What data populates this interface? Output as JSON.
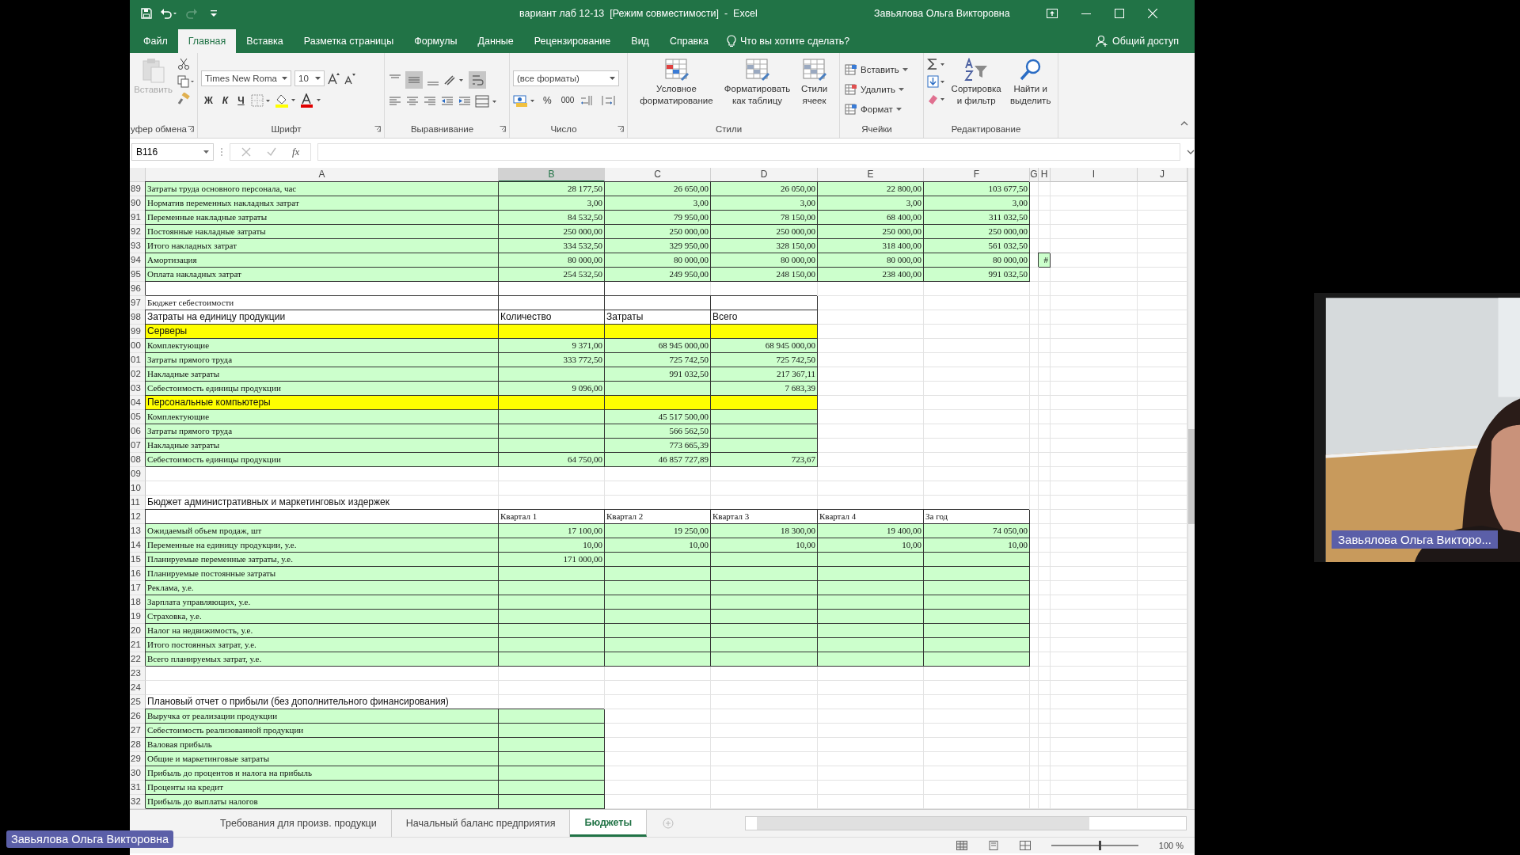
{
  "window": {
    "title": "вариант лаб 12-13  [Режим совместимости]  -  Excel",
    "user": "Завьялова Ольга Викторовна"
  },
  "tabs": [
    {
      "label": "Файл",
      "selected": false
    },
    {
      "label": "Главная",
      "selected": true
    },
    {
      "label": "Вставка",
      "selected": false
    },
    {
      "label": "Разметка страницы",
      "selected": false
    },
    {
      "label": "Формулы",
      "selected": false
    },
    {
      "label": "Данные",
      "selected": false
    },
    {
      "label": "Рецензирование",
      "selected": false
    },
    {
      "label": "Вид",
      "selected": false
    },
    {
      "label": "Справка",
      "selected": false
    }
  ],
  "tell_me": "Что вы хотите сделать?",
  "share": "Общий доступ",
  "ribbon": {
    "clipboard": {
      "paste": "Вставить",
      "label": "уфер обмена"
    },
    "font": {
      "name": "Times New Roma",
      "size": "10",
      "bold": "Ж",
      "italic": "К",
      "underline": "Ч",
      "label": "Шрифт"
    },
    "alignment": {
      "label": "Выравнивание"
    },
    "number": {
      "format": "(все форматы)",
      "percent": "%",
      "thousands": "000",
      "label": "Число"
    },
    "styles": {
      "buttons": [
        "Условное форматирование",
        "Форматировать как таблицу",
        "Стили ячеек"
      ],
      "label": "Стили"
    },
    "cells": {
      "buttons": [
        "Вставить",
        "Удалить",
        "Формат"
      ],
      "label": "Ячейки"
    },
    "editing": {
      "buttons": [
        "Сортировка и фильтр",
        "Найти и выделить"
      ],
      "label": "Редактирование"
    }
  },
  "formula_bar": {
    "name_box": "B116",
    "fx": "fx"
  },
  "columns": [
    {
      "label": "A",
      "selected": false
    },
    {
      "label": "B",
      "selected": true
    },
    {
      "label": "C",
      "selected": false
    },
    {
      "label": "D",
      "selected": false
    },
    {
      "label": "E",
      "selected": false
    },
    {
      "label": "F",
      "selected": false
    },
    {
      "label": "G",
      "selected": false
    },
    {
      "label": "H",
      "selected": false
    },
    {
      "label": "I",
      "selected": false
    },
    {
      "label": "J",
      "selected": false
    }
  ],
  "rows": [
    {
      "num": "89",
      "kind": "data",
      "cells": [
        {
          "text": "Затраты труда основного персонала, час",
          "color": "#ccffcc"
        },
        {
          "text": "28 177,50",
          "color": "#ccffcc"
        },
        {
          "text": "26 650,00",
          "color": "#ccffcc"
        },
        {
          "text": "26 050,00",
          "color": "#ccffcc"
        },
        {
          "text": "22 800,00",
          "color": "#ccffcc"
        },
        {
          "text": "103 677,50",
          "color": "#ccffcc"
        }
      ]
    },
    {
      "num": "90",
      "kind": "data",
      "cells": [
        {
          "text": "Норматив переменных накладных затрат",
          "color": "#ccffcc"
        },
        {
          "text": "3,00",
          "color": "#ccffcc"
        },
        {
          "text": "3,00",
          "color": "#ccffcc"
        },
        {
          "text": "3,00",
          "color": "#ccffcc"
        },
        {
          "text": "3,00",
          "color": "#ccffcc"
        },
        {
          "text": "3,00",
          "color": "#ccffcc"
        }
      ]
    },
    {
      "num": "91",
      "kind": "data",
      "cells": [
        {
          "text": "Переменные накладные затраты",
          "color": "#ccffcc"
        },
        {
          "text": "84 532,50",
          "color": "#ccffcc"
        },
        {
          "text": "79 950,00",
          "color": "#ccffcc"
        },
        {
          "text": "78 150,00",
          "color": "#ccffcc"
        },
        {
          "text": "68 400,00",
          "color": "#ccffcc"
        },
        {
          "text": "311 032,50",
          "color": "#ccffcc"
        }
      ]
    },
    {
      "num": "92",
      "kind": "data",
      "cells": [
        {
          "text": "Постоянные накладные затраты",
          "color": "#ccffcc"
        },
        {
          "text": "250 000,00",
          "color": "#ccffcc"
        },
        {
          "text": "250 000,00",
          "color": "#ccffcc"
        },
        {
          "text": "250 000,00",
          "color": "#ccffcc"
        },
        {
          "text": "250 000,00",
          "color": "#ccffcc"
        },
        {
          "text": "250 000,00",
          "color": "#ccffcc"
        }
      ]
    },
    {
      "num": "93",
      "kind": "data",
      "cells": [
        {
          "text": "Итого накладных затрат",
          "color": "#ccffcc"
        },
        {
          "text": "334 532,50",
          "color": "#ccffcc"
        },
        {
          "text": "329 950,00",
          "color": "#ccffcc"
        },
        {
          "text": "328 150,00",
          "color": "#ccffcc"
        },
        {
          "text": "318 400,00",
          "color": "#ccffcc"
        },
        {
          "text": "561 032,50",
          "color": "#ccffcc"
        }
      ]
    },
    {
      "num": "94",
      "kind": "data",
      "cells": [
        {
          "text": "Амортизация",
          "color": "#ccffcc"
        },
        {
          "text": "80 000,00",
          "color": "#ccffcc"
        },
        {
          "text": "80 000,00",
          "color": "#ccffcc"
        },
        {
          "text": "80 000,00",
          "color": "#ccffcc"
        },
        {
          "text": "80 000,00",
          "color": "#ccffcc"
        },
        {
          "text": "80 000,00",
          "color": "#ccffcc"
        },
        {},
        {
          "text": "#",
          "color": "#ccffcc"
        }
      ]
    },
    {
      "num": "95",
      "kind": "data",
      "cells": [
        {
          "text": "Оплата накладных затрат",
          "color": "#ccffcc"
        },
        {
          "text": "254 532,50",
          "color": "#ccffcc"
        },
        {
          "text": "249 950,00",
          "color": "#ccffcc"
        },
        {
          "text": "248 150,00",
          "color": "#ccffcc"
        },
        {
          "text": "238 400,00",
          "color": "#ccffcc"
        },
        {
          "text": "991 032,50",
          "color": "#ccffcc"
        }
      ]
    },
    {
      "num": "96",
      "kind": "data",
      "cells": [
        {
          "boxed": true
        },
        {
          "boxed": true
        }
      ]
    },
    {
      "num": "97",
      "kind": "labels",
      "cells": [
        {
          "text": "Бюджет себестоимости"
        },
        {
          "boxed": true
        },
        {
          "boxed": true
        },
        {
          "boxed": true
        }
      ]
    },
    {
      "num": "98",
      "kind": "heading",
      "cells": [
        {
          "text": "Затраты на единицу продукции",
          "boxed": true
        },
        {
          "text": "Количество",
          "boxed": true
        },
        {
          "text": "Затраты",
          "boxed": true
        },
        {
          "text": "Всего",
          "boxed": true
        }
      ]
    },
    {
      "num": "99",
      "kind": "heading",
      "cells": [
        {
          "text": "Серверы",
          "color": "#ffff00"
        },
        {
          "color": "#ffff00"
        },
        {
          "color": "#ffff00"
        },
        {
          "color": "#ffff00"
        }
      ]
    },
    {
      "num": "00",
      "kind": "data",
      "cells": [
        {
          "text": "Комплектующие",
          "color": "#ccffcc"
        },
        {
          "text": "9 371,00",
          "color": "#ccffcc"
        },
        {
          "text": "68 945 000,00",
          "color": "#ccffcc"
        },
        {
          "text": "68 945 000,00",
          "color": "#ccffcc"
        }
      ]
    },
    {
      "num": "01",
      "kind": "data",
      "cells": [
        {
          "text": "Затраты прямого труда",
          "color": "#ccffcc"
        },
        {
          "text": "333 772,50",
          "color": "#ccffcc"
        },
        {
          "text": "725 742,50",
          "color": "#ccffcc"
        },
        {
          "text": "725 742,50",
          "color": "#ccffcc"
        }
      ]
    },
    {
      "num": "02",
      "kind": "data",
      "cells": [
        {
          "text": "Накладные затраты",
          "color": "#ccffcc"
        },
        {
          "color": "#ccffcc"
        },
        {
          "text": "991 032,50",
          "color": "#ccffcc"
        },
        {
          "text": "217 367,11",
          "color": "#ccffcc"
        }
      ]
    },
    {
      "num": "03",
      "kind": "data",
      "cells": [
        {
          "text": "Себестоимость единицы продукции",
          "color": "#ccffcc"
        },
        {
          "text": "9 096,00",
          "color": "#ccffcc"
        },
        {
          "color": "#ccffcc"
        },
        {
          "text": "7 683,39",
          "color": "#ccffcc"
        }
      ]
    },
    {
      "num": "04",
      "kind": "heading",
      "cells": [
        {
          "text": "Персональные компьютеры",
          "color": "#ffff00"
        },
        {
          "color": "#ffff00"
        },
        {
          "color": "#ffff00"
        },
        {
          "color": "#ffff00"
        }
      ]
    },
    {
      "num": "05",
      "kind": "data",
      "cells": [
        {
          "text": "Комплектующие",
          "color": "#ccffcc"
        },
        {
          "color": "#ccffcc"
        },
        {
          "text": "45 517 500,00",
          "color": "#ccffcc"
        },
        {
          "color": "#ccffcc"
        }
      ]
    },
    {
      "num": "06",
      "kind": "data",
      "cells": [
        {
          "text": "Затраты прямого труда",
          "color": "#ccffcc"
        },
        {
          "color": "#ccffcc"
        },
        {
          "text": "566 562,50",
          "color": "#ccffcc"
        },
        {
          "color": "#ccffcc"
        }
      ]
    },
    {
      "num": "07",
      "kind": "data",
      "cells": [
        {
          "text": "Накладные затраты",
          "color": "#ccffcc"
        },
        {
          "color": "#ccffcc"
        },
        {
          "text": "773 665,39",
          "color": "#ccffcc"
        },
        {
          "color": "#ccffcc"
        }
      ]
    },
    {
      "num": "08",
      "kind": "data",
      "cells": [
        {
          "text": "Себестоимость единицы продукции",
          "color": "#ccffcc"
        },
        {
          "text": "64 750,00",
          "color": "#ccffcc"
        },
        {
          "text": "46 857 727,89",
          "color": "#ccffcc"
        },
        {
          "text": "723,67",
          "color": "#ccffcc"
        }
      ]
    },
    {
      "num": "09",
      "cells": []
    },
    {
      "num": "10",
      "cells": []
    },
    {
      "num": "11",
      "kind": "heading",
      "cells": [
        {
          "text": "Бюджет административных и маркетинговых издержек"
        }
      ]
    },
    {
      "num": "12",
      "kind": "labels",
      "cells": [
        {
          "boxed": true
        },
        {
          "text": "Квартал 1",
          "boxed": true
        },
        {
          "text": "Квартал 2",
          "boxed": true
        },
        {
          "text": "Квартал 3",
          "boxed": true
        },
        {
          "text": "Квартал 4",
          "boxed": true
        },
        {
          "text": "За год",
          "boxed": true
        }
      ]
    },
    {
      "num": "13",
      "kind": "data",
      "cells": [
        {
          "text": "Ожидаемый объем продаж, шт",
          "color": "#ccffcc"
        },
        {
          "text": "17 100,00",
          "color": "#ccffcc"
        },
        {
          "text": "19 250,00",
          "color": "#ccffcc"
        },
        {
          "text": "18 300,00",
          "color": "#ccffcc"
        },
        {
          "text": "19 400,00",
          "color": "#ccffcc"
        },
        {
          "text": "74 050,00",
          "color": "#ccffcc"
        }
      ]
    },
    {
      "num": "14",
      "kind": "data",
      "cells": [
        {
          "text": "Переменные на единицу продукции, у.е.",
          "color": "#ccffcc"
        },
        {
          "text": "10,00",
          "color": "#ccffcc"
        },
        {
          "text": "10,00",
          "color": "#ccffcc"
        },
        {
          "text": "10,00",
          "color": "#ccffcc"
        },
        {
          "text": "10,00",
          "color": "#ccffcc"
        },
        {
          "text": "10,00",
          "color": "#ccffcc"
        }
      ]
    },
    {
      "num": "15",
      "kind": "data",
      "cells": [
        {
          "text": "Планируемые переменные затраты, у.е.",
          "color": "#ccffcc"
        },
        {
          "text": "171 000,00",
          "color": "#ccffcc"
        },
        {
          "color": "#ccffcc"
        },
        {
          "color": "#ccffcc"
        },
        {
          "color": "#ccffcc"
        },
        {
          "color": "#ccffcc"
        }
      ]
    },
    {
      "num": "16",
      "kind": "data",
      "cells": [
        {
          "text": "Планируемые постоянные затраты",
          "color": "#ccffcc"
        },
        {
          "color": "#ccffcc"
        },
        {
          "color": "#ccffcc"
        },
        {
          "color": "#ccffcc"
        },
        {
          "color": "#ccffcc"
        },
        {
          "color": "#ccffcc"
        }
      ]
    },
    {
      "num": "17",
      "kind": "data",
      "cells": [
        {
          "text": "Реклама, у.е.",
          "color": "#ccffcc"
        },
        {
          "color": "#ccffcc"
        },
        {
          "color": "#ccffcc"
        },
        {
          "color": "#ccffcc"
        },
        {
          "color": "#ccffcc"
        },
        {
          "color": "#ccffcc"
        }
      ]
    },
    {
      "num": "18",
      "kind": "data",
      "cells": [
        {
          "text": "Зарплата управляющих, у.е.",
          "color": "#ccffcc"
        },
        {
          "color": "#ccffcc"
        },
        {
          "color": "#ccffcc"
        },
        {
          "color": "#ccffcc"
        },
        {
          "color": "#ccffcc"
        },
        {
          "color": "#ccffcc"
        }
      ]
    },
    {
      "num": "19",
      "kind": "data",
      "cells": [
        {
          "text": "Страховка, у.е.",
          "color": "#ccffcc"
        },
        {
          "color": "#ccffcc"
        },
        {
          "color": "#ccffcc"
        },
        {
          "color": "#ccffcc"
        },
        {
          "color": "#ccffcc"
        },
        {
          "color": "#ccffcc"
        }
      ]
    },
    {
      "num": "20",
      "kind": "data",
      "cells": [
        {
          "text": "Налог на недвижимость, у.е.",
          "color": "#ccffcc"
        },
        {
          "color": "#ccffcc"
        },
        {
          "color": "#ccffcc"
        },
        {
          "color": "#ccffcc"
        },
        {
          "color": "#ccffcc"
        },
        {
          "color": "#ccffcc"
        }
      ]
    },
    {
      "num": "21",
      "kind": "data",
      "cells": [
        {
          "text": "Итого постоянных затрат, у.е.",
          "color": "#ccffcc"
        },
        {
          "color": "#ccffcc"
        },
        {
          "color": "#ccffcc"
        },
        {
          "color": "#ccffcc"
        },
        {
          "color": "#ccffcc"
        },
        {
          "color": "#ccffcc"
        }
      ]
    },
    {
      "num": "22",
      "kind": "data",
      "cells": [
        {
          "text": "Всего планируемых затрат, у.е.",
          "color": "#ccffcc"
        },
        {
          "color": "#ccffcc"
        },
        {
          "color": "#ccffcc"
        },
        {
          "color": "#ccffcc"
        },
        {
          "color": "#ccffcc"
        },
        {
          "color": "#ccffcc"
        }
      ]
    },
    {
      "num": "23",
      "cells": []
    },
    {
      "num": "24",
      "cells": []
    },
    {
      "num": "25",
      "kind": "heading",
      "cells": [
        {
          "text": "Плановый отчет о прибыли (без дополнительного финансирования)"
        }
      ]
    },
    {
      "num": "26",
      "kind": "data",
      "cells": [
        {
          "text": "Выручка от реализации продукции",
          "color": "#ccffcc"
        },
        {
          "color": "#ccffcc"
        }
      ]
    },
    {
      "num": "27",
      "kind": "data",
      "cells": [
        {
          "text": "Себестоимость реализованной продукции",
          "color": "#ccffcc"
        },
        {
          "color": "#ccffcc"
        }
      ]
    },
    {
      "num": "28",
      "kind": "data",
      "cells": [
        {
          "text": "Валовая прибыль",
          "color": "#ccffcc"
        },
        {
          "color": "#ccffcc"
        }
      ]
    },
    {
      "num": "29",
      "kind": "data",
      "cells": [
        {
          "text": "Общие и маркетинговые затраты",
          "color": "#ccffcc"
        },
        {
          "color": "#ccffcc"
        }
      ]
    },
    {
      "num": "30",
      "kind": "data",
      "cells": [
        {
          "text": "Прибыль до процентов и налога на прибыль",
          "color": "#ccffcc"
        },
        {
          "color": "#ccffcc"
        }
      ]
    },
    {
      "num": "31",
      "kind": "data",
      "cells": [
        {
          "text": "Проценты на кредит",
          "color": "#ccffcc"
        },
        {
          "color": "#ccffcc"
        }
      ]
    },
    {
      "num": "32",
      "kind": "data",
      "cells": [
        {
          "text": "Прибыль до выплаты налогов",
          "color": "#ccffcc"
        },
        {
          "color": "#ccffcc"
        }
      ]
    }
  ],
  "sheets": [
    {
      "label": "Требования для произв. продукци",
      "selected": false
    },
    {
      "label": "Начальный баланс предприятия",
      "selected": false
    },
    {
      "label": "Бюджеты",
      "selected": true
    }
  ],
  "status_bar": {
    "zoom": "100 %",
    "zoom_slider": {
      "level": 0.55
    }
  },
  "video_tile": {
    "name": "Завьялова Ольга Викторо..."
  },
  "presenter_label": "Завьялова Ольга Викторовна"
}
